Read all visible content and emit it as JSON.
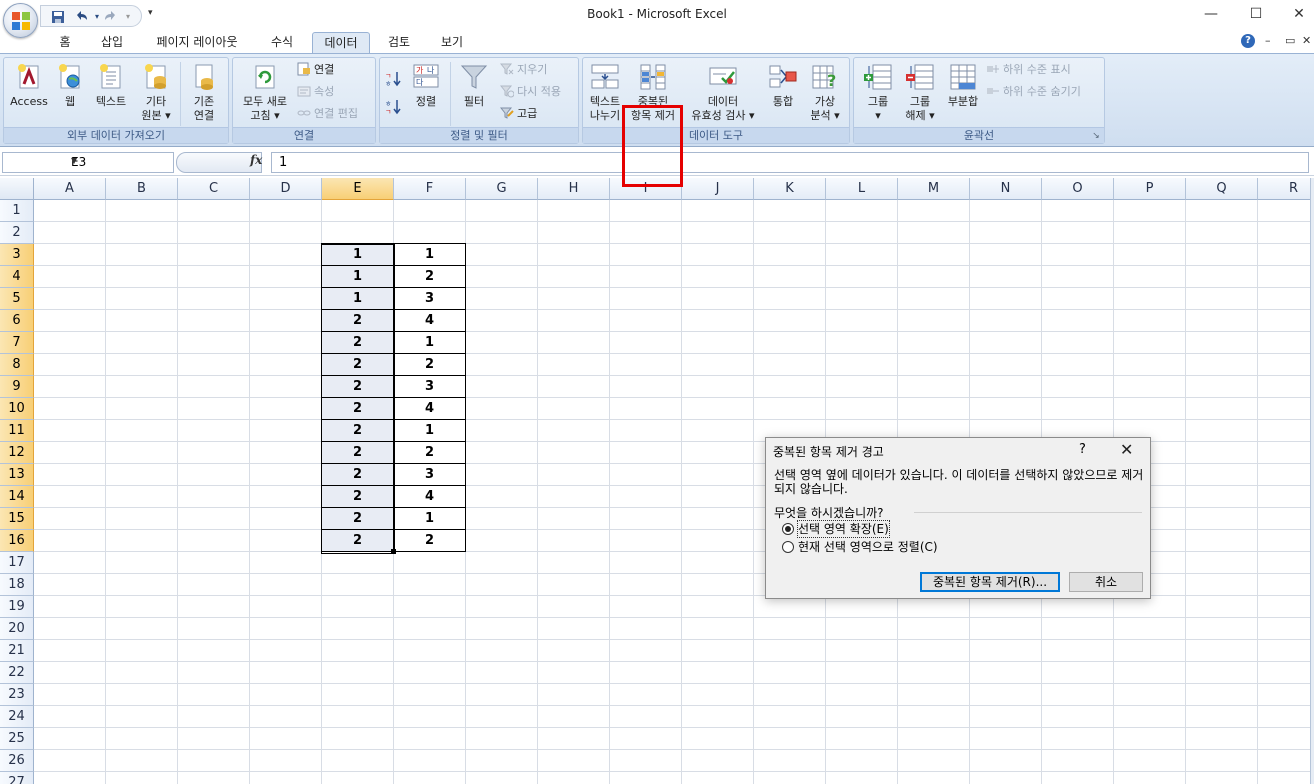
{
  "window": {
    "title": "Book1 - Microsoft Excel"
  },
  "qat": {
    "items": [
      "save-icon",
      "undo-icon",
      "redo-icon"
    ]
  },
  "tabs": [
    "홈",
    "삽입",
    "페이지 레이아웃",
    "수식",
    "데이터",
    "검토",
    "보기"
  ],
  "active_tab": "데이터",
  "ribbon": {
    "external_data": {
      "label": "외부 데이터 가져오기",
      "access": "Access",
      "web": "웹",
      "text": "텍스트",
      "other_l1": "기타",
      "other_l2": "원본",
      "existing_l1": "기존",
      "existing_l2": "연결"
    },
    "connections": {
      "label": "연결",
      "refresh_l1": "모두 새로",
      "refresh_l2": "고침",
      "connections": "연결",
      "properties": "속성",
      "edit_links": "연결 편집"
    },
    "sort_filter": {
      "label": "정렬 및 필터",
      "sort": "정렬",
      "filter": "필터",
      "clear": "지우기",
      "reapply": "다시 적용",
      "advanced": "고급",
      "az": "가나 다",
      "za": "하"
    },
    "data_tools": {
      "label": "데이터 도구",
      "text_to_col_l1": "텍스트",
      "text_to_col_l2": "나누기",
      "remove_dup_l1": "중복된",
      "remove_dup_l2": "항목 제거",
      "validation_l1": "데이터",
      "validation_l2": "유효성 검사",
      "consolidate": "통합",
      "whatif_l1": "가상",
      "whatif_l2": "분석"
    },
    "outline": {
      "label": "윤곽선",
      "group_l1": "그룹",
      "ungroup_l1": "그룹",
      "ungroup_l2": "해제",
      "subtotal": "부분합",
      "show_detail": "하위 수준 표시",
      "hide_detail": "하위 수준 숨기기"
    }
  },
  "formula_bar": {
    "name_box": "E3",
    "fx": "fx",
    "value": "1"
  },
  "columns": [
    "A",
    "B",
    "C",
    "D",
    "E",
    "F",
    "G",
    "H",
    "I",
    "J",
    "K",
    "L",
    "M",
    "N",
    "O",
    "P",
    "Q",
    "R"
  ],
  "rows": [
    "1",
    "2",
    "3",
    "4",
    "5",
    "6",
    "7",
    "8",
    "9",
    "10",
    "11",
    "12",
    "13",
    "14",
    "15",
    "16",
    "17",
    "18",
    "19",
    "20",
    "21",
    "22",
    "23",
    "24",
    "25",
    "26",
    "27"
  ],
  "selected_column": "E",
  "cells": {
    "E": [
      "1",
      "1",
      "1",
      "2",
      "2",
      "2",
      "2",
      "2",
      "2",
      "2",
      "2",
      "2",
      "2",
      "2"
    ],
    "F": [
      "1",
      "2",
      "3",
      "4",
      "1",
      "2",
      "3",
      "4",
      "1",
      "2",
      "3",
      "4",
      "1",
      "2"
    ]
  },
  "dialog": {
    "title": "중복된 항목 제거 경고",
    "help": "?",
    "close": "✕",
    "message": "선택 영역 옆에 데이터가 있습니다. 이 데이터를 선택하지 않았으므로 제거되지 않습니다.",
    "question": "무엇을 하시겠습니까?",
    "option_expand": "선택 영역 확장(E)",
    "option_continue": "현재 선택 영역으로 정렬(C)",
    "remove_button": "중복된 항목 제거(R)...",
    "cancel_button": "취소"
  }
}
